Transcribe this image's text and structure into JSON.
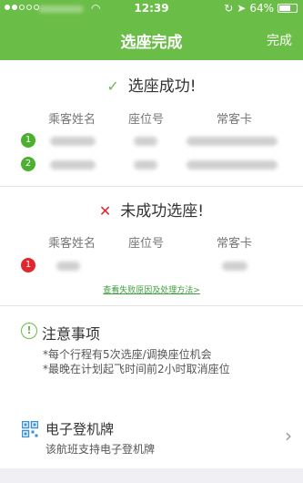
{
  "status": {
    "time": "12:39",
    "battery": "64%"
  },
  "nav": {
    "title": "选座完成",
    "done": "完成"
  },
  "success": {
    "heading": "选座成功!",
    "col_name": "乘客姓名",
    "col_seat": "座位号",
    "col_card": "常客卡",
    "rows": [
      {
        "index": "1"
      },
      {
        "index": "2"
      }
    ]
  },
  "failure": {
    "heading": "未成功选座!",
    "col_name": "乘客姓名",
    "col_seat": "座位号",
    "col_card": "常客卡",
    "rows": [
      {
        "index": "1"
      }
    ],
    "link": "查看失败原因及处理方法>"
  },
  "notice": {
    "title": "注意事项",
    "lines": [
      "*每个行程有5次选座/调换座位机会",
      "*最晚在计划起飞时间前2小时取消座位"
    ]
  },
  "boarding": {
    "title": "电子登机牌",
    "subtitle": "该航班支持电子登机牌"
  },
  "colors": {
    "accent": "#6abd46",
    "success_badge": "#4caf2f",
    "failure_badge": "#e3262d"
  }
}
